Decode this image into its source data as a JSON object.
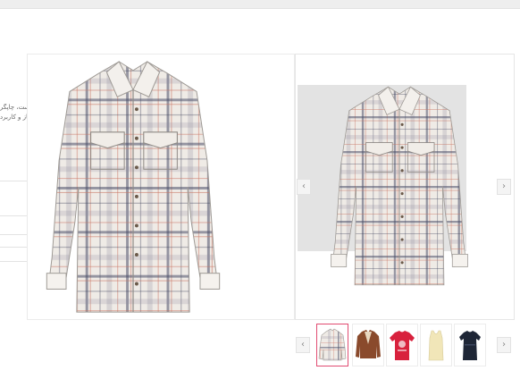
{
  "page": {
    "behind_text_lines": [
      "ست، چاپگر",
      "باز و کاربرد"
    ]
  },
  "gallery": {
    "prev_arrow": "‹",
    "next_arrow": "›"
  },
  "thumbnails": {
    "prev_arrow": "‹",
    "next_arrow": "›",
    "items": [
      {
        "name": "plaid-shirt",
        "color": "#d9d3cc",
        "active": true
      },
      {
        "name": "brown-jacket",
        "color": "#8a4a2c",
        "active": false
      },
      {
        "name": "red-tshirt",
        "color": "#d8213d",
        "active": false
      },
      {
        "name": "cream-tank-top",
        "color": "#f1e6b8",
        "active": false
      },
      {
        "name": "navy-top",
        "color": "#1e2636",
        "active": false
      }
    ]
  },
  "colors": {
    "selected_border": "#e14b71",
    "shirt_base": "#efebe6",
    "plaid_navy": "#3a3f58",
    "plaid_red": "#c97462"
  }
}
